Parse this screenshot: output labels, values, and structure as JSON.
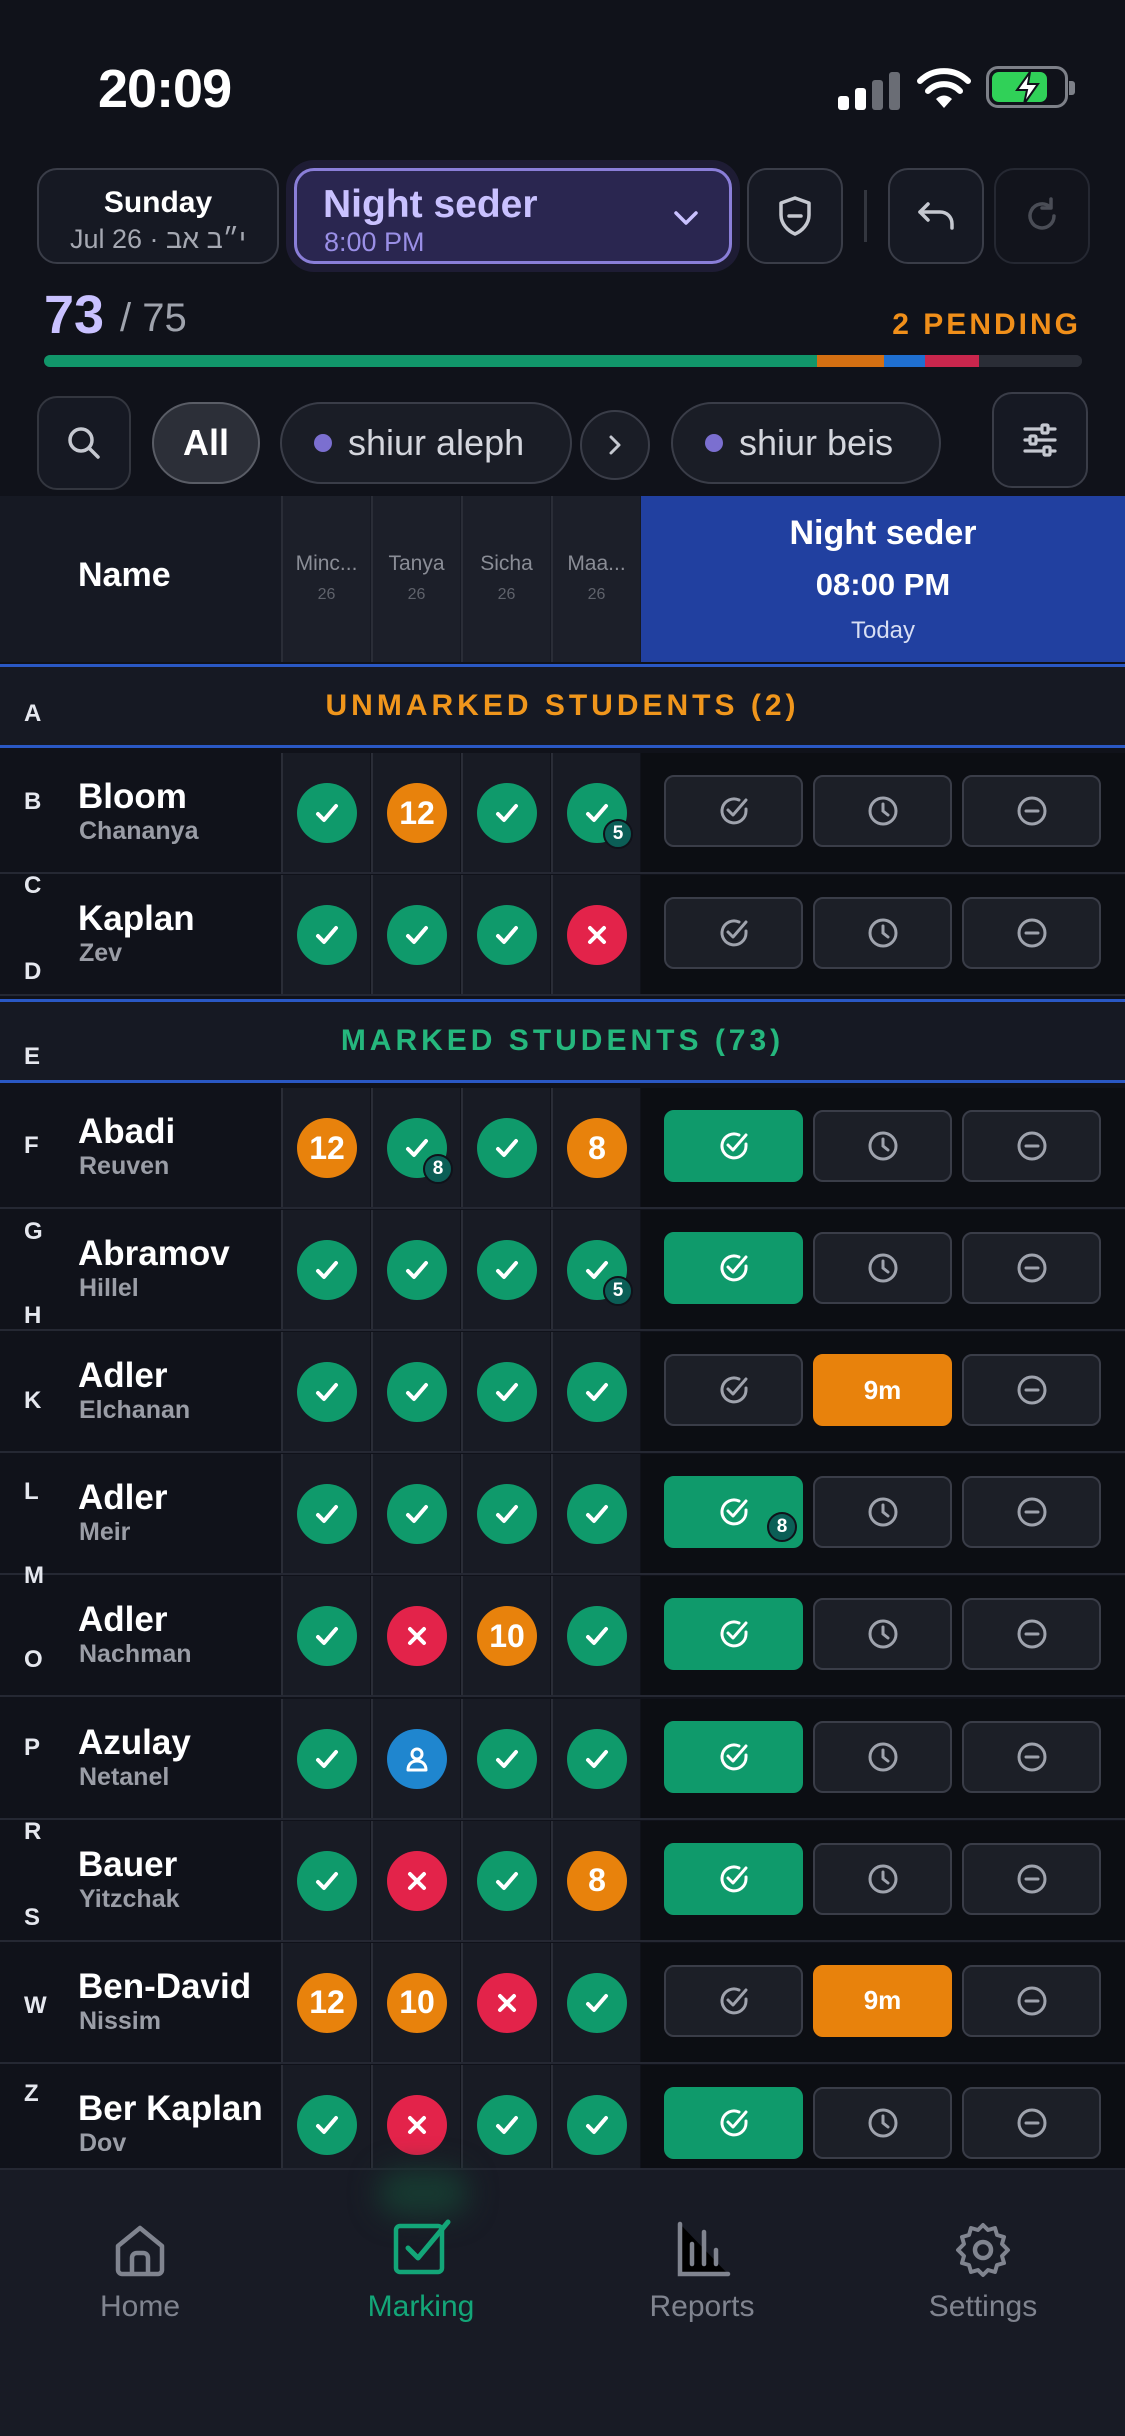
{
  "status_bar": {
    "time": "20:09"
  },
  "header": {
    "date": {
      "day": "Sunday",
      "date_line": "Jul 26 · י״ב אב"
    },
    "seder": {
      "name": "Night seder",
      "time": "8:00 PM"
    }
  },
  "counts": {
    "marked": "73",
    "total": "/ 75",
    "pending": "2 PENDING",
    "progress": [
      {
        "fraction": 0.745,
        "color": "#11966a"
      },
      {
        "fraction": 0.064,
        "color": "#d46f12"
      },
      {
        "fraction": 0.04,
        "color": "#1f6fd1"
      },
      {
        "fraction": 0.052,
        "color": "#c9264d"
      },
      {
        "fraction": 0.099,
        "color": "#2a2d36"
      }
    ]
  },
  "filters": {
    "all": "All",
    "groups": [
      "shiur aleph",
      "shiur beis"
    ]
  },
  "table_header": {
    "name": "Name",
    "columns": [
      {
        "label": "Minc...",
        "sub": "26"
      },
      {
        "label": "Tanya",
        "sub": "26"
      },
      {
        "label": "Sicha",
        "sub": "26"
      },
      {
        "label": "Maa...",
        "sub": "26"
      }
    ],
    "active": {
      "title": "Night seder",
      "time": "08:00 PM",
      "when": "Today"
    }
  },
  "sections": {
    "unmarked": "UNMARKED STUDENTS (2)",
    "marked": "MARKED STUDENTS (73)"
  },
  "alpha_index": [
    "A",
    "B",
    "C",
    "D",
    "E",
    "F",
    "G",
    "H",
    "K",
    "L",
    "M",
    "O",
    "P",
    "R",
    "S",
    "W",
    "Z"
  ],
  "students_unmarked": [
    {
      "last": "Bloom",
      "first": "Chananya",
      "cells": [
        {
          "s": "check"
        },
        {
          "s": "num",
          "v": "12"
        },
        {
          "s": "check"
        },
        {
          "s": "check",
          "sub": "5"
        }
      ],
      "action": {
        "sel": "none"
      }
    },
    {
      "last": "Kaplan",
      "first": "Zev",
      "cells": [
        {
          "s": "check"
        },
        {
          "s": "check"
        },
        {
          "s": "check"
        },
        {
          "s": "x"
        }
      ],
      "action": {
        "sel": "none"
      }
    }
  ],
  "students_marked": [
    {
      "last": "Abadi",
      "first": "Reuven",
      "cells": [
        {
          "s": "num",
          "v": "12"
        },
        {
          "s": "check",
          "sub": "8"
        },
        {
          "s": "check"
        },
        {
          "s": "num",
          "v": "8"
        }
      ],
      "action": {
        "sel": "present"
      }
    },
    {
      "last": "Abramov",
      "first": "Hillel",
      "cells": [
        {
          "s": "check"
        },
        {
          "s": "check"
        },
        {
          "s": "check"
        },
        {
          "s": "check",
          "sub": "5"
        }
      ],
      "action": {
        "sel": "present"
      }
    },
    {
      "last": "Adler",
      "first": "Elchanan",
      "cells": [
        {
          "s": "check"
        },
        {
          "s": "check"
        },
        {
          "s": "check"
        },
        {
          "s": "check"
        }
      ],
      "action": {
        "sel": "late",
        "late_label": "9m"
      }
    },
    {
      "last": "Adler",
      "first": "Meir",
      "cells": [
        {
          "s": "check"
        },
        {
          "s": "check"
        },
        {
          "s": "check"
        },
        {
          "s": "check"
        }
      ],
      "action": {
        "sel": "present",
        "sub": "8"
      }
    },
    {
      "last": "Adler",
      "first": "Nachman",
      "cells": [
        {
          "s": "check"
        },
        {
          "s": "x"
        },
        {
          "s": "num",
          "v": "10"
        },
        {
          "s": "check"
        }
      ],
      "action": {
        "sel": "present"
      }
    },
    {
      "last": "Azulay",
      "first": "Netanel",
      "cells": [
        {
          "s": "check"
        },
        {
          "s": "person"
        },
        {
          "s": "check"
        },
        {
          "s": "check"
        }
      ],
      "action": {
        "sel": "present"
      }
    },
    {
      "last": "Bauer",
      "first": "Yitzchak",
      "cells": [
        {
          "s": "check"
        },
        {
          "s": "x"
        },
        {
          "s": "check"
        },
        {
          "s": "num",
          "v": "8"
        }
      ],
      "action": {
        "sel": "present"
      }
    },
    {
      "last": "Ben-David",
      "first": "Nissim",
      "cells": [
        {
          "s": "num",
          "v": "12"
        },
        {
          "s": "num",
          "v": "10"
        },
        {
          "s": "x"
        },
        {
          "s": "check"
        }
      ],
      "action": {
        "sel": "late",
        "late_label": "9m"
      }
    },
    {
      "last": "Ber Kaplan",
      "first": "Dov",
      "cells": [
        {
          "s": "check"
        },
        {
          "s": "x"
        },
        {
          "s": "check"
        },
        {
          "s": "check"
        }
      ],
      "action": {
        "sel": "present"
      }
    }
  ],
  "tabs": [
    {
      "label": "Home",
      "icon": "home-icon"
    },
    {
      "label": "Marking",
      "icon": "marking-icon",
      "active": true
    },
    {
      "label": "Reports",
      "icon": "reports-icon"
    },
    {
      "label": "Settings",
      "icon": "settings-icon"
    }
  ],
  "colors": {
    "present": "#0f9a6b",
    "late": "#e8820c",
    "absent": "#e3234a",
    "excused": "#1f86cf",
    "accent": "#c9c1ff",
    "header_active": "#2140a0"
  }
}
